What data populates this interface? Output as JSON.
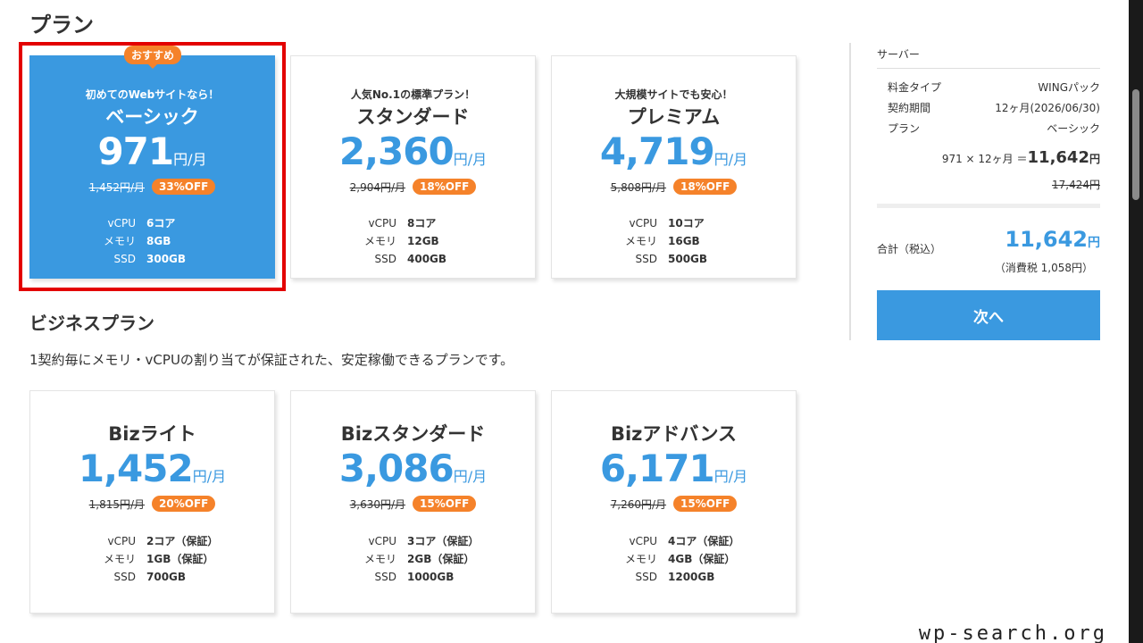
{
  "plans_title": "プラン",
  "plan_cards": [
    {
      "tagline": "初めてのWebサイトなら！",
      "name": "ベーシック",
      "price": "971",
      "unit": "円/月",
      "orig_price": "1,452円/月",
      "off": "33%OFF",
      "specs": [
        {
          "k": "vCPU",
          "v": "6コア"
        },
        {
          "k": "メモリ",
          "v": "8GB"
        },
        {
          "k": "SSD",
          "v": "300GB"
        }
      ]
    },
    {
      "tagline": "人気No.1の標準プラン！",
      "name": "スタンダード",
      "price": "2,360",
      "unit": "円/月",
      "orig_price": "2,904円/月",
      "off": "18%OFF",
      "specs": [
        {
          "k": "vCPU",
          "v": "8コア"
        },
        {
          "k": "メモリ",
          "v": "12GB"
        },
        {
          "k": "SSD",
          "v": "400GB"
        }
      ]
    },
    {
      "tagline": "大規模サイトでも安心！",
      "name": "プレミアム",
      "price": "4,719",
      "unit": "円/月",
      "orig_price": "5,808円/月",
      "off": "18%OFF",
      "specs": [
        {
          "k": "vCPU",
          "v": "10コア"
        },
        {
          "k": "メモリ",
          "v": "16GB"
        },
        {
          "k": "SSD",
          "v": "500GB"
        }
      ]
    }
  ],
  "recommend_badge": "おすすめ",
  "biz_title": "ビジネスプラン",
  "biz_desc": "1契約毎にメモリ・vCPUの割り当てが保証された、安定稼働できるプランです。",
  "biz_cards": [
    {
      "name": "Bizライト",
      "price": "1,452",
      "unit": "円/月",
      "orig_price": "1,815円/月",
      "off": "20%OFF",
      "specs": [
        {
          "k": "vCPU",
          "v": "2コア（保証）"
        },
        {
          "k": "メモリ",
          "v": "1GB（保証）"
        },
        {
          "k": "SSD",
          "v": "700GB"
        }
      ]
    },
    {
      "name": "Bizスタンダード",
      "price": "3,086",
      "unit": "円/月",
      "orig_price": "3,630円/月",
      "off": "15%OFF",
      "specs": [
        {
          "k": "vCPU",
          "v": "3コア（保証）"
        },
        {
          "k": "メモリ",
          "v": "2GB（保証）"
        },
        {
          "k": "SSD",
          "v": "1000GB"
        }
      ]
    },
    {
      "name": "Bizアドバンス",
      "price": "6,171",
      "unit": "円/月",
      "orig_price": "7,260円/月",
      "off": "15%OFF",
      "specs": [
        {
          "k": "vCPU",
          "v": "4コア（保証）"
        },
        {
          "k": "メモリ",
          "v": "4GB（保証）"
        },
        {
          "k": "SSD",
          "v": "1200GB"
        }
      ]
    }
  ],
  "summary": {
    "label": "サーバー",
    "rows": [
      {
        "k": "料金タイプ",
        "v": "WINGパック"
      },
      {
        "k": "契約期間",
        "v": "12ヶ月(2026/06/30)"
      },
      {
        "k": "プラン",
        "v": "ベーシック"
      }
    ],
    "calc_formula": "971 × 12ヶ月 ＝",
    "calc_amount": "11,642",
    "calc_yen": "円",
    "calc_orig": "17,424円",
    "total_label": "合計（税込）",
    "total_amount": "11,642",
    "total_yen": "円",
    "tax_note": "（消費税 1,058円）",
    "next_label": "次へ"
  },
  "watermark": "wp-search.org",
  "colors": {
    "accent": "#3a99e0",
    "badge": "#f5822a",
    "highlight": "#e30000"
  }
}
